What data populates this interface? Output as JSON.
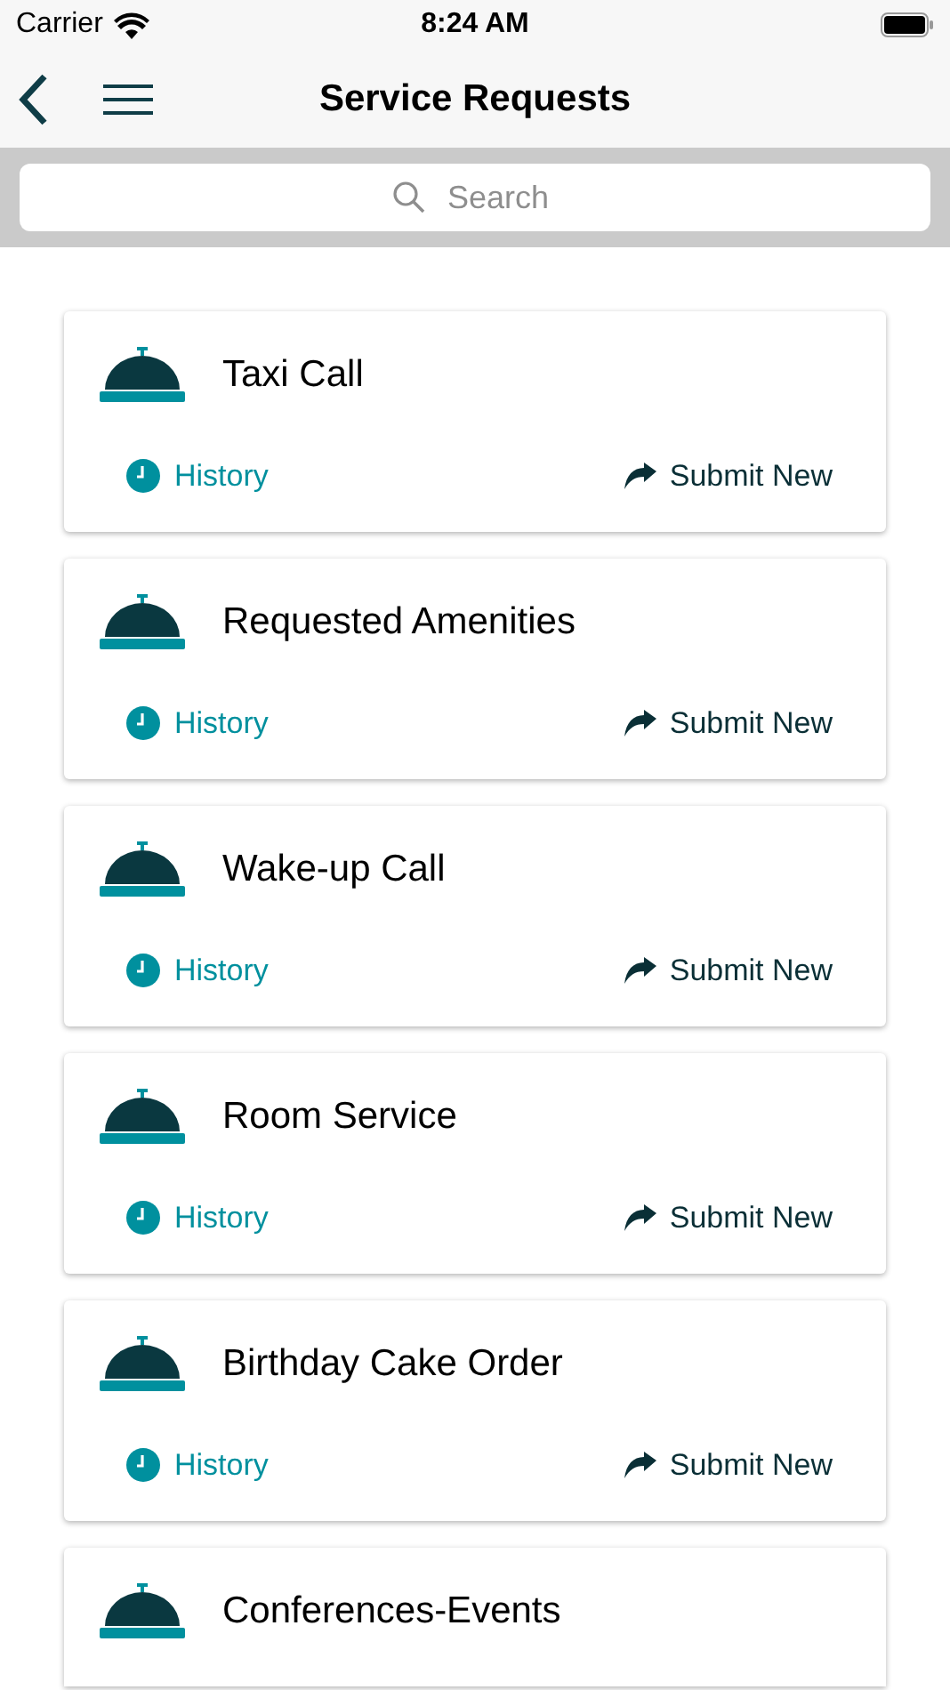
{
  "status_bar": {
    "carrier": "Carrier",
    "time": "8:24 AM"
  },
  "nav": {
    "title": "Service Requests"
  },
  "search": {
    "placeholder": "Search"
  },
  "requests": [
    {
      "title": "Taxi Call",
      "history": "History",
      "submit": "Submit New"
    },
    {
      "title": "Requested Amenities",
      "history": "History",
      "submit": "Submit New"
    },
    {
      "title": "Wake-up Call",
      "history": "History",
      "submit": "Submit New"
    },
    {
      "title": "Room Service",
      "history": "History",
      "submit": "Submit New"
    },
    {
      "title": "Birthday Cake Order",
      "history": "History",
      "submit": "Submit New"
    },
    {
      "title": "Conferences-Events"
    }
  ]
}
